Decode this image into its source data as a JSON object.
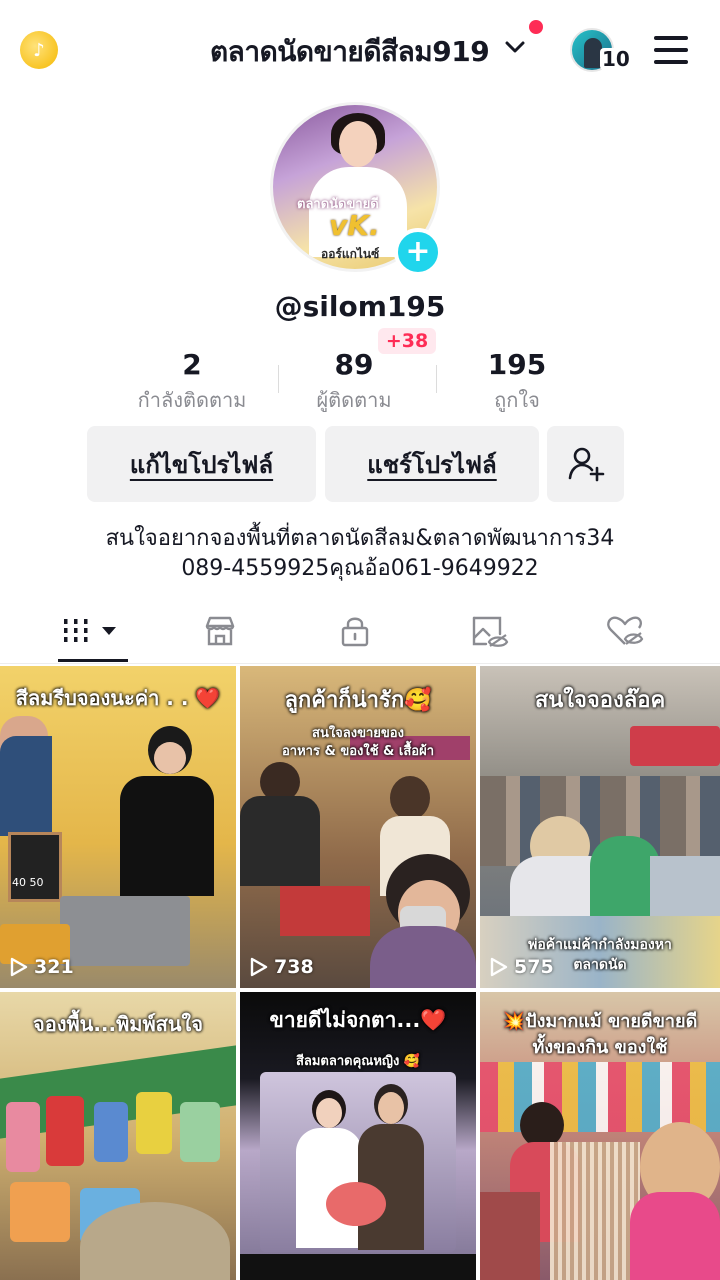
{
  "header": {
    "username": "ตลาดนัดขายดีสีลม919",
    "switch_count": "10"
  },
  "profile": {
    "avatar_text_line1": "ตลาดนัดขายดี",
    "avatar_text_line2": "vK.",
    "avatar_text_line3": "ออร์แกไนซ์",
    "handle": "@silom195",
    "followers_delta": "+38"
  },
  "stats": [
    {
      "value": "2",
      "label": "กำลังติดตาม"
    },
    {
      "value": "89",
      "label": "ผู้ติดตาม"
    },
    {
      "value": "195",
      "label": "ถูกใจ"
    }
  ],
  "buttons": {
    "edit_profile": "แก้ไขโปรไฟล์",
    "share_profile": "แชร์โปรไฟล์"
  },
  "bio": {
    "line1": "สนใจอยากจองพื้นที่ตลาดนัดสีลม&ตลาดพัฒนาการ34",
    "line2": "089-4559925คุณอ้อ061-9649922"
  },
  "tabs": [
    {
      "icon": "grid-icon",
      "active": true
    },
    {
      "icon": "shop-icon",
      "active": false
    },
    {
      "icon": "lock-icon",
      "active": false
    },
    {
      "icon": "tagged-hidden-icon",
      "active": false
    },
    {
      "icon": "liked-hidden-icon",
      "active": false
    }
  ],
  "videos": [
    {
      "caption": "สีลมรีบจองนะค่า . . ❤️",
      "views": "321",
      "board": "40 50"
    },
    {
      "caption": "ลูกค้าก็น่ารัก🥰",
      "sub1": "สนใจลงขายของ",
      "sub2": "อาหาร & ของใช้ & เสื้อผ้า",
      "views": "738"
    },
    {
      "caption": "สนใจจองล๊อค",
      "overlay": "พ่อค้าแม่ค้ากำลังมองหา",
      "overlay2": "ตลาดนัด",
      "views": "575"
    },
    {
      "caption": "จองพื้น...พิมพ์สนใจ"
    },
    {
      "caption": "ขายดีไม่จกตา...❤️",
      "sub1": "สีลมตลาดคุณหญิง 🥰"
    },
    {
      "caption": "💥ปังมากแม้ ขายดีขายดี",
      "sub1": "ทั้งของกิน ของใช้"
    }
  ],
  "colors": {
    "accent_red": "#fe2c55",
    "accent_cyan": "#20d5ec",
    "text_primary": "#161823",
    "text_secondary": "#8a8b91",
    "button_bg": "#f1f1f2"
  }
}
